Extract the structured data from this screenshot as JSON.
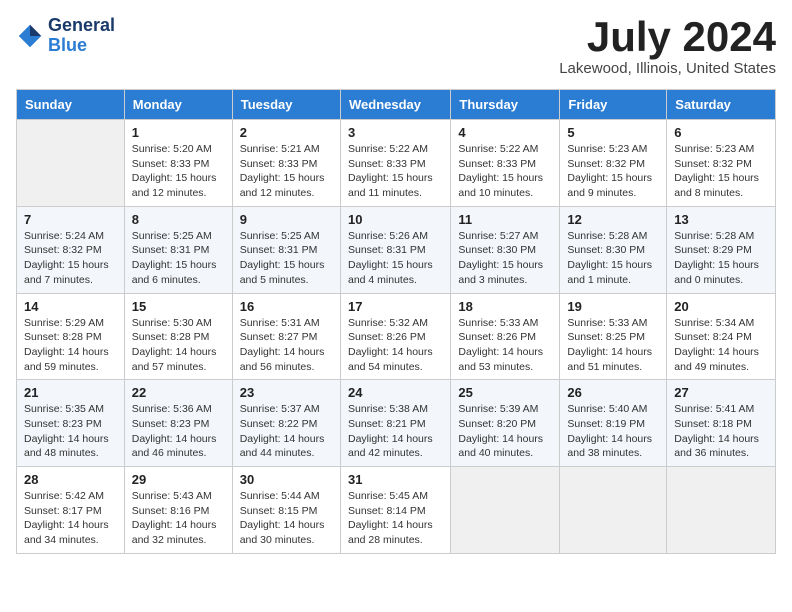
{
  "header": {
    "logo_text_general": "General",
    "logo_text_blue": "Blue",
    "month_year": "July 2024",
    "location": "Lakewood, Illinois, United States"
  },
  "days_of_week": [
    "Sunday",
    "Monday",
    "Tuesday",
    "Wednesday",
    "Thursday",
    "Friday",
    "Saturday"
  ],
  "weeks": [
    [
      {
        "day": "",
        "info": ""
      },
      {
        "day": "1",
        "info": "Sunrise: 5:20 AM\nSunset: 8:33 PM\nDaylight: 15 hours\nand 12 minutes."
      },
      {
        "day": "2",
        "info": "Sunrise: 5:21 AM\nSunset: 8:33 PM\nDaylight: 15 hours\nand 12 minutes."
      },
      {
        "day": "3",
        "info": "Sunrise: 5:22 AM\nSunset: 8:33 PM\nDaylight: 15 hours\nand 11 minutes."
      },
      {
        "day": "4",
        "info": "Sunrise: 5:22 AM\nSunset: 8:33 PM\nDaylight: 15 hours\nand 10 minutes."
      },
      {
        "day": "5",
        "info": "Sunrise: 5:23 AM\nSunset: 8:32 PM\nDaylight: 15 hours\nand 9 minutes."
      },
      {
        "day": "6",
        "info": "Sunrise: 5:23 AM\nSunset: 8:32 PM\nDaylight: 15 hours\nand 8 minutes."
      }
    ],
    [
      {
        "day": "7",
        "info": "Sunrise: 5:24 AM\nSunset: 8:32 PM\nDaylight: 15 hours\nand 7 minutes."
      },
      {
        "day": "8",
        "info": "Sunrise: 5:25 AM\nSunset: 8:31 PM\nDaylight: 15 hours\nand 6 minutes."
      },
      {
        "day": "9",
        "info": "Sunrise: 5:25 AM\nSunset: 8:31 PM\nDaylight: 15 hours\nand 5 minutes."
      },
      {
        "day": "10",
        "info": "Sunrise: 5:26 AM\nSunset: 8:31 PM\nDaylight: 15 hours\nand 4 minutes."
      },
      {
        "day": "11",
        "info": "Sunrise: 5:27 AM\nSunset: 8:30 PM\nDaylight: 15 hours\nand 3 minutes."
      },
      {
        "day": "12",
        "info": "Sunrise: 5:28 AM\nSunset: 8:30 PM\nDaylight: 15 hours\nand 1 minute."
      },
      {
        "day": "13",
        "info": "Sunrise: 5:28 AM\nSunset: 8:29 PM\nDaylight: 15 hours\nand 0 minutes."
      }
    ],
    [
      {
        "day": "14",
        "info": "Sunrise: 5:29 AM\nSunset: 8:28 PM\nDaylight: 14 hours\nand 59 minutes."
      },
      {
        "day": "15",
        "info": "Sunrise: 5:30 AM\nSunset: 8:28 PM\nDaylight: 14 hours\nand 57 minutes."
      },
      {
        "day": "16",
        "info": "Sunrise: 5:31 AM\nSunset: 8:27 PM\nDaylight: 14 hours\nand 56 minutes."
      },
      {
        "day": "17",
        "info": "Sunrise: 5:32 AM\nSunset: 8:26 PM\nDaylight: 14 hours\nand 54 minutes."
      },
      {
        "day": "18",
        "info": "Sunrise: 5:33 AM\nSunset: 8:26 PM\nDaylight: 14 hours\nand 53 minutes."
      },
      {
        "day": "19",
        "info": "Sunrise: 5:33 AM\nSunset: 8:25 PM\nDaylight: 14 hours\nand 51 minutes."
      },
      {
        "day": "20",
        "info": "Sunrise: 5:34 AM\nSunset: 8:24 PM\nDaylight: 14 hours\nand 49 minutes."
      }
    ],
    [
      {
        "day": "21",
        "info": "Sunrise: 5:35 AM\nSunset: 8:23 PM\nDaylight: 14 hours\nand 48 minutes."
      },
      {
        "day": "22",
        "info": "Sunrise: 5:36 AM\nSunset: 8:23 PM\nDaylight: 14 hours\nand 46 minutes."
      },
      {
        "day": "23",
        "info": "Sunrise: 5:37 AM\nSunset: 8:22 PM\nDaylight: 14 hours\nand 44 minutes."
      },
      {
        "day": "24",
        "info": "Sunrise: 5:38 AM\nSunset: 8:21 PM\nDaylight: 14 hours\nand 42 minutes."
      },
      {
        "day": "25",
        "info": "Sunrise: 5:39 AM\nSunset: 8:20 PM\nDaylight: 14 hours\nand 40 minutes."
      },
      {
        "day": "26",
        "info": "Sunrise: 5:40 AM\nSunset: 8:19 PM\nDaylight: 14 hours\nand 38 minutes."
      },
      {
        "day": "27",
        "info": "Sunrise: 5:41 AM\nSunset: 8:18 PM\nDaylight: 14 hours\nand 36 minutes."
      }
    ],
    [
      {
        "day": "28",
        "info": "Sunrise: 5:42 AM\nSunset: 8:17 PM\nDaylight: 14 hours\nand 34 minutes."
      },
      {
        "day": "29",
        "info": "Sunrise: 5:43 AM\nSunset: 8:16 PM\nDaylight: 14 hours\nand 32 minutes."
      },
      {
        "day": "30",
        "info": "Sunrise: 5:44 AM\nSunset: 8:15 PM\nDaylight: 14 hours\nand 30 minutes."
      },
      {
        "day": "31",
        "info": "Sunrise: 5:45 AM\nSunset: 8:14 PM\nDaylight: 14 hours\nand 28 minutes."
      },
      {
        "day": "",
        "info": ""
      },
      {
        "day": "",
        "info": ""
      },
      {
        "day": "",
        "info": ""
      }
    ]
  ]
}
